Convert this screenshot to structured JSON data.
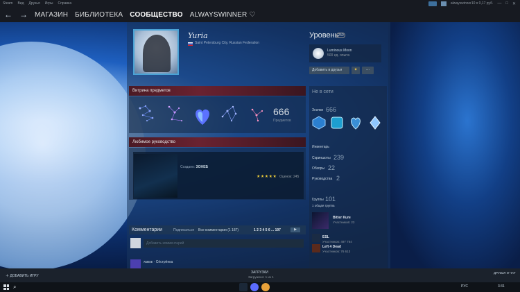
{
  "menu": {
    "items": [
      "Steam",
      "Вид",
      "Друзья",
      "Игры",
      "Справка"
    ],
    "account": "alwayswinner10 ▾ 0,17 руб."
  },
  "nav": {
    "back": "←",
    "forward": "→",
    "links": [
      "МАГАЗИН",
      "БИБЛИОТЕКА",
      "СООБЩЕСТВО",
      "ALWAYSWINNER ♡"
    ]
  },
  "profile": {
    "username": "Yuria",
    "location": "Saint Petersburg City, Russian Federation"
  },
  "level": {
    "label": "Уровень",
    "value": "250"
  },
  "badge_card": {
    "title": "Luminous Moon",
    "xp": "500 ед. опыта"
  },
  "buttons": {
    "add_friend": "Добавить в друзья",
    "award": "✦",
    "more": "..."
  },
  "showcase": {
    "title": "Витрина предметов",
    "count": "666",
    "count_label": "Предметов"
  },
  "guide": {
    "title": "Любимое руководство",
    "guide_prefix": "Создано:",
    "guide_author": "ЗОНЕБ",
    "stars": "★★★★★",
    "rating": "Оценок: 245"
  },
  "comments": {
    "title": "Комментарии",
    "subscribe": "Подписаться",
    "view_all": "Все комментарии (1 187)",
    "pages": "1 2 3 4 5 6 ... 197",
    "go": "▶",
    "input_placeholder": "Добавить комментарий",
    "second_name": "ᴀᴍᴇᴇᴇ · Сёстрёнка"
  },
  "sidebar": {
    "status": "Не в сети",
    "badges_label": "Значки",
    "badges_count": "666",
    "inventory_label": "Инвентарь",
    "screenshots_label": "Скриншоты",
    "screenshots_count": "239",
    "reviews_label": "Обзоры",
    "reviews_count": "22",
    "guides_label": "Руководства",
    "guides_count": "2",
    "groups_label": "Группы",
    "groups_count": "101",
    "groups_sub": "1 общая группа",
    "groups": [
      {
        "name": "Bitter Kure",
        "members": "Участников: 23"
      },
      {
        "name": "ESL",
        "members": "Участников: 497 764"
      },
      {
        "name": "Left 4 Dead",
        "members": "Участников: 76 613"
      }
    ]
  },
  "bottom": {
    "add_game": "ДОБАВИТЬ ИГРУ",
    "downloads_title": "ЗАГРУЗКИ",
    "downloads_sub": "Загружено: 1 из 1",
    "friends": "ДРУЗЬЯ И ЧАТ"
  },
  "taskbar": {
    "tray": "РУС",
    "time": "3:31"
  },
  "colors": {
    "accent_blue": "#4aa3d6",
    "section_header": "#6a2230",
    "panel": "#19375f",
    "topbar": "#171a21"
  }
}
